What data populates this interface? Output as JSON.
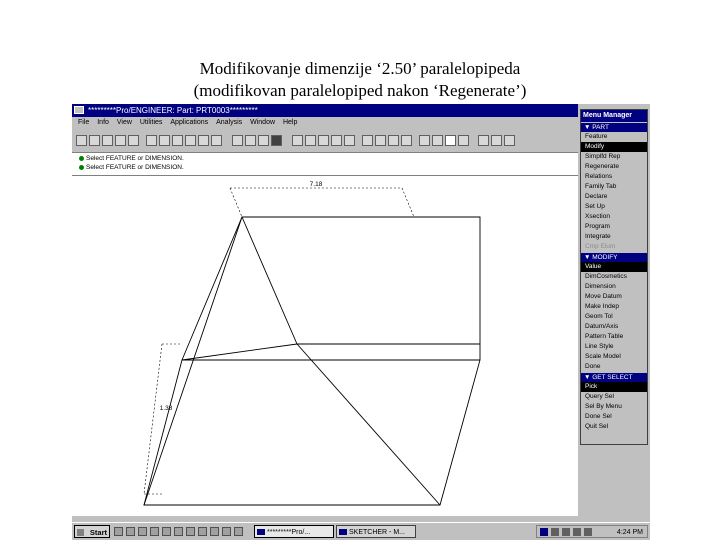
{
  "slide": {
    "title_line1": "Modifikovanje dimenzije ‘2.50’ paralelopipeda",
    "title_line2": "(modifikovan paralelopiped nakon ‘Regenerate’)"
  },
  "window": {
    "title": "*********Pro/ENGINEER: Part: PRT0003*********"
  },
  "menubar": [
    "File",
    "Info",
    "View",
    "Utilities",
    "Applications",
    "Analysis",
    "Window",
    "Help"
  ],
  "messages": [
    "Select FEATURE or DIMENSION.",
    "Select FEATURE or DIMENSION."
  ],
  "dimensions": {
    "width": "7.18",
    "height": "1.38"
  },
  "menu_manager": {
    "title": "Menu Manager",
    "sections": [
      {
        "header": "▼ PART",
        "items": [
          {
            "label": "Feature",
            "state": "normal"
          },
          {
            "label": "Modify",
            "state": "selected"
          },
          {
            "label": "Simplfd Rep",
            "state": "normal"
          },
          {
            "label": "Regenerate",
            "state": "normal"
          },
          {
            "label": "Relations",
            "state": "normal"
          },
          {
            "label": "Family Tab",
            "state": "normal"
          },
          {
            "label": "Declare",
            "state": "normal"
          },
          {
            "label": "Set Up",
            "state": "normal"
          },
          {
            "label": "Xsection",
            "state": "normal"
          },
          {
            "label": "Program",
            "state": "normal"
          },
          {
            "label": "Integrate",
            "state": "normal"
          },
          {
            "label": "Cmp Elum",
            "state": "disabled"
          }
        ]
      },
      {
        "header": "▼ MODIFY",
        "items": [
          {
            "label": "Value",
            "state": "selected"
          },
          {
            "label": "DimCosmetics",
            "state": "normal"
          },
          {
            "label": "Dimension",
            "state": "normal"
          },
          {
            "label": "Move Datum",
            "state": "normal"
          },
          {
            "label": "Make Indep",
            "state": "normal"
          },
          {
            "label": "Geom Tol",
            "state": "normal"
          },
          {
            "label": "Datum/Axis",
            "state": "normal"
          },
          {
            "label": "Pattern Table",
            "state": "normal"
          },
          {
            "label": "Line Style",
            "state": "normal"
          },
          {
            "label": "Scale Model",
            "state": "normal"
          },
          {
            "label": "Done",
            "state": "normal"
          }
        ]
      },
      {
        "header": "▼ GET SELECT",
        "items": [
          {
            "label": "Pick",
            "state": "selected"
          },
          {
            "label": "Query Sel",
            "state": "normal"
          },
          {
            "label": "Sel By Menu",
            "state": "normal"
          },
          {
            "label": "Done Sel",
            "state": "normal"
          },
          {
            "label": "Quit Sel",
            "state": "normal"
          }
        ]
      }
    ]
  },
  "taskbar": {
    "start_label": "Start",
    "tasks": [
      {
        "label": "*********Pro/...",
        "active": true
      },
      {
        "label": "SKETCHER - M...",
        "active": false
      }
    ],
    "clock": "4:24 PM"
  }
}
